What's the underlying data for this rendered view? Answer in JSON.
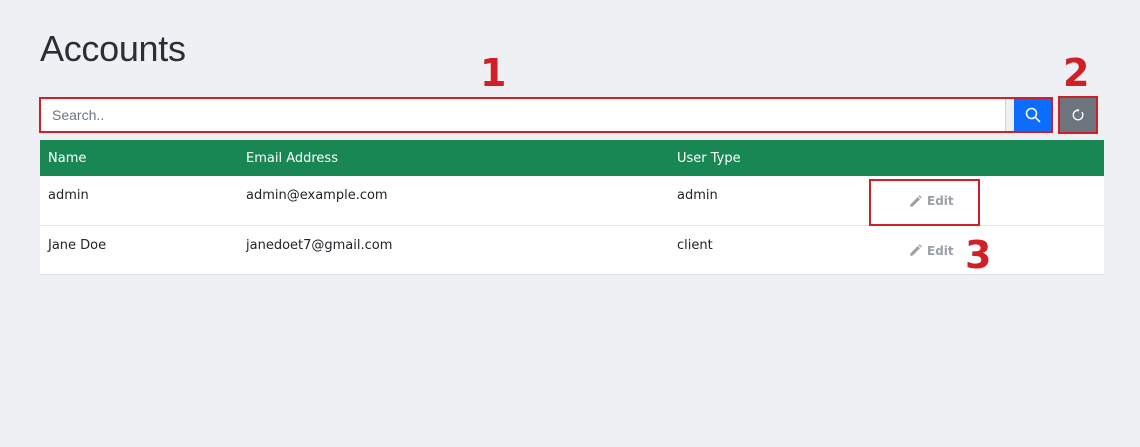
{
  "page": {
    "title": "Accounts"
  },
  "search": {
    "placeholder": "Search..",
    "value": "",
    "search_icon": "search-icon",
    "refresh_icon": "refresh-icon",
    "search_button_color": "#0d6efd",
    "refresh_button_color": "#6c757d"
  },
  "table": {
    "header_color": "#198754",
    "columns": [
      "Name",
      "Email Address",
      "User Type",
      ""
    ],
    "rows": [
      {
        "name": "admin",
        "email": "admin@example.com",
        "type": "admin",
        "action": "Edit"
      },
      {
        "name": "Jane Doe",
        "email": "janedoet7@gmail.com",
        "type": "client",
        "action": "Edit"
      }
    ],
    "edit_icon": "pencil-icon"
  },
  "annotations": {
    "color": "#d01f26",
    "labels": [
      "1",
      "2",
      "3"
    ]
  }
}
